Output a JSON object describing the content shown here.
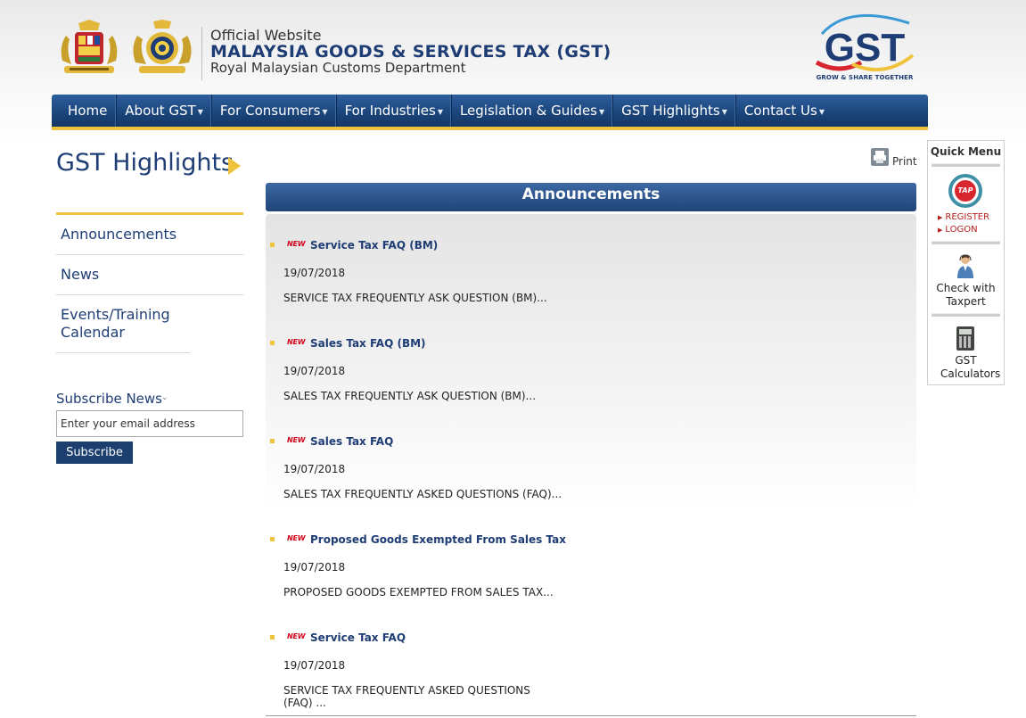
{
  "header": {
    "line1": "Official Website",
    "line2": "MALAYSIA GOODS & SERVICES TAX (GST)",
    "line3": "Royal Malaysian Customs Department",
    "logo_text": "GST",
    "logo_tagline": "GROW & SHARE TOGETHER"
  },
  "nav": {
    "items": [
      {
        "label": "Home",
        "has_dropdown": false
      },
      {
        "label": "About GST",
        "has_dropdown": true
      },
      {
        "label": "For Consumers",
        "has_dropdown": true
      },
      {
        "label": "For Industries",
        "has_dropdown": true
      },
      {
        "label": "Legislation & Guides",
        "has_dropdown": true
      },
      {
        "label": "GST Highlights",
        "has_dropdown": true
      },
      {
        "label": "Contact Us",
        "has_dropdown": true
      }
    ]
  },
  "sidebar": {
    "title": "GST Highlights",
    "items": [
      {
        "label": "Announcements"
      },
      {
        "label": "News"
      },
      {
        "label": "Events/Training Calendar"
      }
    ],
    "subscribe_label": "Subscribe News",
    "email_placeholder": "Enter your email address",
    "subscribe_button": "Subscribe"
  },
  "toolbar": {
    "print_label": "Print"
  },
  "announcements": {
    "header": "Announcements",
    "badge": "NEW",
    "items": [
      {
        "title": "Service Tax FAQ (BM)",
        "date": "19/07/2018",
        "description": "SERVICE TAX FREQUENTLY ASK QUESTION (BM)..."
      },
      {
        "title": "Sales Tax FAQ (BM)",
        "date": "19/07/2018",
        "description": "SALES TAX FREQUENTLY ASK QUESTION (BM)..."
      },
      {
        "title": "Sales Tax FAQ",
        "date": "19/07/2018",
        "description": "SALES TAX FREQUENTLY ASKED QUESTIONS (FAQ)..."
      },
      {
        "title": "Proposed Goods Exempted From Sales Tax",
        "date": "19/07/2018",
        "description": "PROPOSED GOODS EXEMPTED FROM SALES TAX..."
      },
      {
        "title": "Service Tax FAQ",
        "date": "19/07/2018",
        "description": "SERVICE TAX FREQUENTLY ASKED QUESTIONS (FAQ) ..."
      }
    ]
  },
  "quick_menu": {
    "title": "Quick Menu",
    "tap_label": "TAP",
    "register_label": "REGISTER",
    "logon_label": "LOGON",
    "taxpert_label": "Check with Taxpert",
    "calculator_label": "GST Calculators"
  },
  "colors": {
    "brand_navy": "#1f3d75",
    "accent_yellow": "#f0c33c",
    "nav_blue": "#1b4479",
    "new_badge_red": "#d0021b"
  }
}
